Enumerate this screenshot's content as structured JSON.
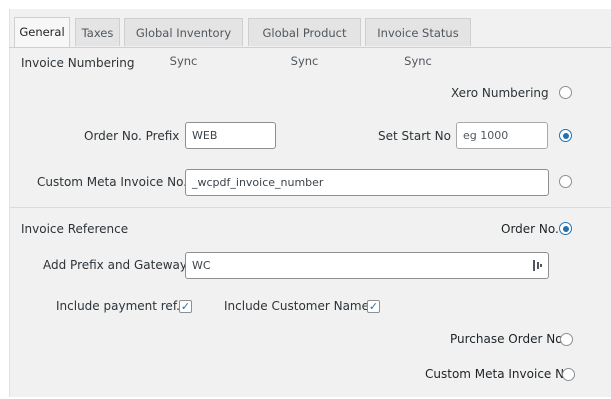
{
  "tabs": [
    {
      "label": "General",
      "active": true
    },
    {
      "label": "Taxes",
      "active": false
    },
    {
      "label": "Global Inventory Sync",
      "active": false
    },
    {
      "label": "Global Product Sync",
      "active": false
    },
    {
      "label": "Invoice Status Sync",
      "active": false
    }
  ],
  "invoice_numbering": {
    "title": "Invoice Numbering",
    "xero_numbering_label": "Xero Numbering",
    "xero_numbering_selected": false,
    "order_prefix_label": "Order No. Prefix",
    "order_prefix_value": "WEB",
    "set_start_label": "Set Start No",
    "set_start_placeholder": "eg 1000",
    "set_start_selected": true,
    "custom_meta_label": "Custom Meta Invoice No.",
    "custom_meta_value": "_wcpdf_invoice_number",
    "custom_meta_selected": false
  },
  "invoice_reference": {
    "title": "Invoice Reference",
    "order_no_label": "Order No.",
    "order_no_selected": true,
    "prefix_gateway_label": "Add Prefix and Gateway",
    "prefix_gateway_value": "WC",
    "include_payment_label": "Include payment ref.",
    "include_payment_checked": true,
    "include_customer_label": "Include Customer Name",
    "include_customer_checked": true,
    "purchase_order_label": "Purchase Order No.",
    "purchase_order_selected": false,
    "custom_meta_label": "Custom Meta Invoice No.",
    "custom_meta_selected": false
  },
  "colors": {
    "accent": "#2271b1",
    "panel_bg": "#f1f1f1",
    "tab_bg": "#e4e4e4"
  }
}
